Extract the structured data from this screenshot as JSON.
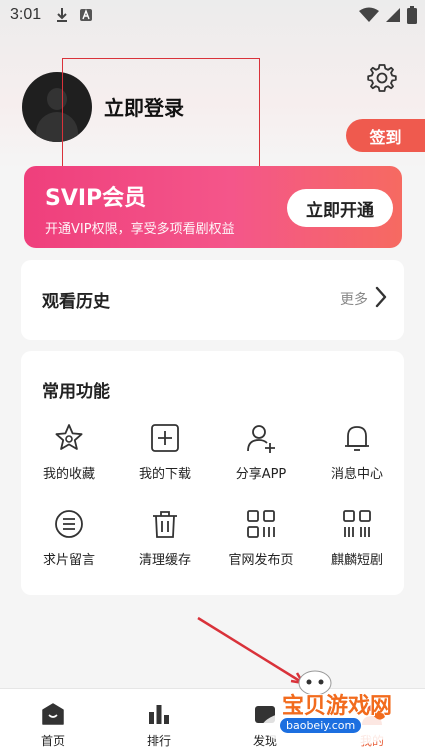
{
  "status_bar": {
    "time": "3:01"
  },
  "profile": {
    "login_label": "立即登录",
    "checkin_label": "签到"
  },
  "svip": {
    "title": "SVIP会员",
    "description": "开通VIP权限，享受多项看剧权益",
    "button_label": "立即开通",
    "gradient_start": "#ef3f7c",
    "gradient_end": "#f66a61"
  },
  "history": {
    "title": "观看历史",
    "more_label": "更多"
  },
  "functions": {
    "title": "常用功能",
    "items": [
      {
        "label": "我的收藏",
        "icon": "star-icon"
      },
      {
        "label": "我的下载",
        "icon": "download-box-icon"
      },
      {
        "label": "分享APP",
        "icon": "add-user-icon"
      },
      {
        "label": "消息中心",
        "icon": "bell-icon"
      },
      {
        "label": "求片留言",
        "icon": "list-circle-icon"
      },
      {
        "label": "清理缓存",
        "icon": "trash-icon"
      },
      {
        "label": "官网发布页",
        "icon": "grid-icon"
      },
      {
        "label": "麒麟短剧",
        "icon": "apps-icon"
      }
    ]
  },
  "bottom_nav": {
    "items": [
      {
        "label": "首页",
        "icon": "home-icon"
      },
      {
        "label": "排行",
        "icon": "chart-icon"
      },
      {
        "label": "发现",
        "icon": "discover-icon"
      },
      {
        "label": "我的",
        "icon": "profile-icon"
      }
    ]
  },
  "watermark": {
    "text": "宝贝游戏网",
    "url": "baobeiy.com"
  },
  "colors": {
    "accent": "#ef5a4e",
    "red_box": "#d9323a"
  }
}
